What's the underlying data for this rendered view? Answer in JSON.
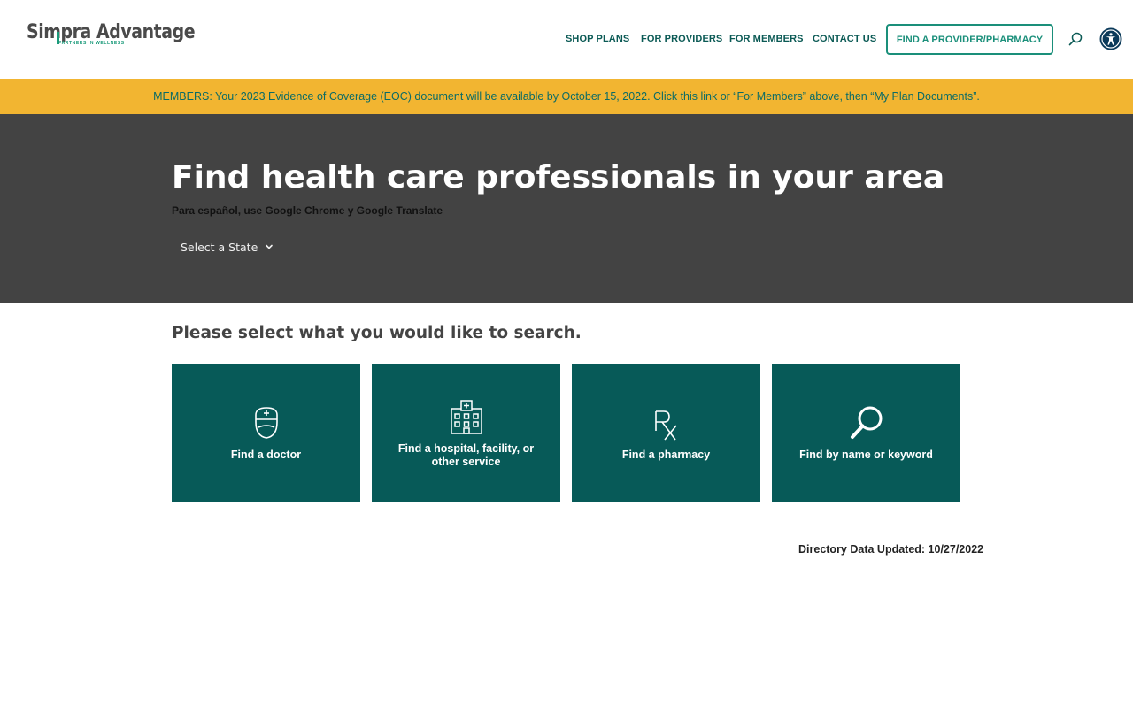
{
  "header": {
    "logo_text": "Simpra Advantage",
    "logo_tagline": "PARTNERS IN WELLNESS",
    "nav": [
      {
        "label": "SHOP PLANS"
      },
      {
        "label": "FOR PROVIDERS"
      },
      {
        "label": "FOR MEMBERS"
      },
      {
        "label": "CONTACT US"
      }
    ],
    "cta_label": "FIND A PROVIDER/PHARMACY",
    "search_icon": "search-icon",
    "accessibility_icon": "accessibility-icon"
  },
  "banner": {
    "text": "MEMBERS: Your 2023 Evidence of Coverage (EOC) document will be available by October 15, 2022. Click this link or “For Members” above, then “My Plan Documents”."
  },
  "hero": {
    "title": "Find health care professionals in your area",
    "subtitle": "Para español, use Google Chrome y Google Translate",
    "state_select": {
      "selected": "Select a State"
    }
  },
  "search": {
    "prompt": "Please select what you would like to search.",
    "tiles": [
      {
        "label": "Find a doctor",
        "icon": "doctor-icon"
      },
      {
        "label": "Find a hospital, facility, or other service",
        "icon": "hospital-icon"
      },
      {
        "label": "Find a pharmacy",
        "icon": "rx-icon"
      },
      {
        "label": "Find by name or keyword",
        "icon": "magnifier-icon"
      }
    ]
  },
  "footer_note": "Directory Data Updated: 10/27/2022",
  "colors": {
    "teal": "#075a58",
    "accent_green": "#1a8f7a",
    "banner_yellow": "#f2b531",
    "hero_gray": "#434343"
  }
}
